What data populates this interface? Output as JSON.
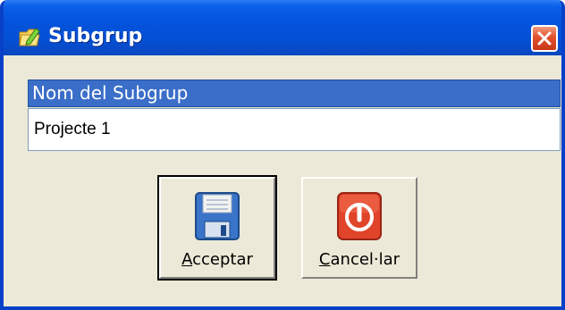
{
  "window": {
    "title": "Subgrup",
    "accent": "#0553dc"
  },
  "form": {
    "label": "Nom del Subgrup",
    "value": "Projecte 1",
    "label_bg": "#3a6ec8"
  },
  "buttons": {
    "accept": {
      "label_first": "A",
      "label_rest": "cceptar",
      "icon": "save-icon"
    },
    "cancel": {
      "label_first": "C",
      "label_rest": "ancel·lar",
      "icon": "power-icon"
    }
  },
  "icons": {
    "app": "folder-edit-icon",
    "close": "close-icon"
  }
}
